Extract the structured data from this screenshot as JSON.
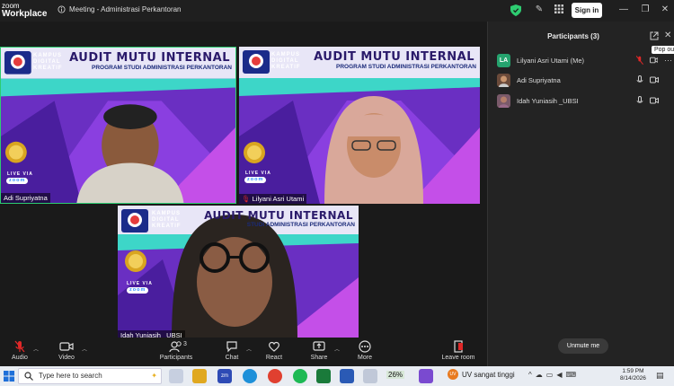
{
  "app": {
    "logo_line1": "zoom",
    "logo_line2": "Workplace",
    "meeting_title": "Meeting - Administrasi Perkantoran",
    "signin_label": "Sign in"
  },
  "tiles": [
    {
      "name": "Adi Supriyatna",
      "banner_title": "AUDIT MUTU INTERNAL",
      "banner_sub": "PROGRAM STUDI ADMINISTRASI PERKANTORAN",
      "kampus": "KAMPUS DIGITAL KREATIF",
      "live": "LIVE VIA",
      "zoom": "zoom"
    },
    {
      "name": "Lilyani Asri Utami",
      "banner_title": "AUDIT MUTU INTERNAL",
      "banner_sub": "PROGRAM STUDI ADMINISTRASI PERKANTORAN",
      "kampus": "KAMPUS DIGITAL KREATIF",
      "live": "LIVE VIA",
      "zoom": "zoom"
    },
    {
      "name": "Idah Yuniasih _UBSI",
      "banner_title": "AUDIT MUTU INTERNAL",
      "banner_sub": "STUDI ADMINISTRASI PERKANTORAN",
      "kampus": "KAMPUS DIGITAL KREATIF",
      "live": "LIVE VIA",
      "zoom": "zoom"
    }
  ],
  "panel": {
    "title": "Participants (3)",
    "tooltip": "Pop out",
    "participants": [
      {
        "initials": "LA",
        "name": "Lilyani Asri Utami (Me)",
        "muted": true
      },
      {
        "initials": "",
        "name": "Adi Supriyatna",
        "muted": false
      },
      {
        "initials": "",
        "name": "Idah Yuniasih _UBSI",
        "muted": false
      }
    ],
    "unmute_label": "Unmute me"
  },
  "toolbar": {
    "audio": "Audio",
    "video": "Video",
    "participants": "Participants",
    "participants_count": "3",
    "chat": "Chat",
    "react": "React",
    "share": "Share",
    "more": "More",
    "leave": "Leave room"
  },
  "taskbar": {
    "search_placeholder": "Type here to search",
    "battery_percent": "26%",
    "uv_text": "UV sangat tinggi",
    "time": "1:59 PM",
    "date": "8/14/2026"
  },
  "colors": {
    "accent_green": "#2ecc71",
    "banner_purple": "#5b2fb3",
    "leave_red": "#e02828"
  }
}
